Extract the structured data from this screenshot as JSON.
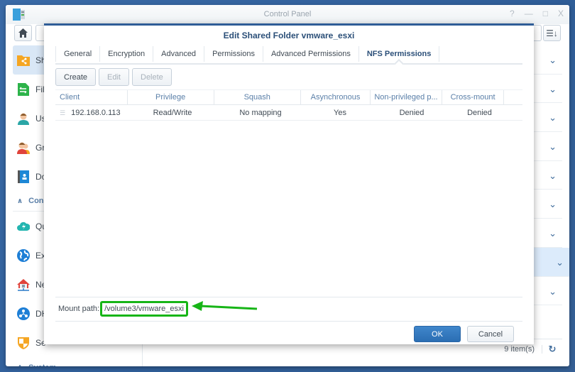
{
  "window": {
    "title": "Control Panel",
    "controls": {
      "help": "?",
      "minimize": "—",
      "maximize": "□",
      "close": "X"
    }
  },
  "sidebar": {
    "items": [
      {
        "label": "Shared Folder",
        "visible_label": "Sh",
        "icon": "shared-folder-icon",
        "selected": true
      },
      {
        "label": "File Services",
        "visible_label": "Fil",
        "icon": "file-services-icon"
      },
      {
        "label": "User",
        "visible_label": "Us",
        "icon": "user-icon"
      },
      {
        "label": "Group",
        "visible_label": "Gr",
        "icon": "group-icon"
      },
      {
        "label": "Domain/LDAP",
        "visible_label": "Do",
        "icon": "domain-icon"
      }
    ],
    "group_connectivity": "Con",
    "items2": [
      {
        "label": "QuickConnect",
        "visible_label": "Qu",
        "icon": "quickconnect-icon"
      },
      {
        "label": "External Access",
        "visible_label": "Ex",
        "icon": "external-access-icon"
      },
      {
        "label": "Network",
        "visible_label": "Ne",
        "icon": "network-icon"
      },
      {
        "label": "DHCP Server",
        "visible_label": "DH",
        "icon": "dhcp-icon"
      },
      {
        "label": "Security",
        "visible_label": "Se",
        "icon": "security-icon"
      }
    ],
    "group_system": "System"
  },
  "main": {
    "rows": 9,
    "highlighted_row": 8,
    "items_count": "9 item(s)"
  },
  "dialog": {
    "title": "Edit Shared Folder vmware_esxi",
    "tabs": [
      "General",
      "Encryption",
      "Advanced",
      "Permissions",
      "Advanced Permissions",
      "NFS Permissions"
    ],
    "active_tab": "NFS Permissions",
    "buttons": {
      "create": "Create",
      "edit": "Edit",
      "delete": "Delete"
    },
    "columns": [
      "Client",
      "Privilege",
      "Squash",
      "Asynchronous",
      "Non-privileged p...",
      "Cross-mount"
    ],
    "rows": [
      {
        "client": "192.168.0.113",
        "privilege": "Read/Write",
        "squash": "No mapping",
        "asynchronous": "Yes",
        "non_privileged": "Denied",
        "cross_mount": "Denied"
      }
    ],
    "mount_path_label": "Mount path:",
    "mount_path_value": "/volume3/vmware_esxi",
    "ok": "OK",
    "cancel": "Cancel"
  },
  "colors": {
    "accent": "#2f5d97",
    "highlight": "#17b517",
    "ok": "#2b6eb3"
  }
}
